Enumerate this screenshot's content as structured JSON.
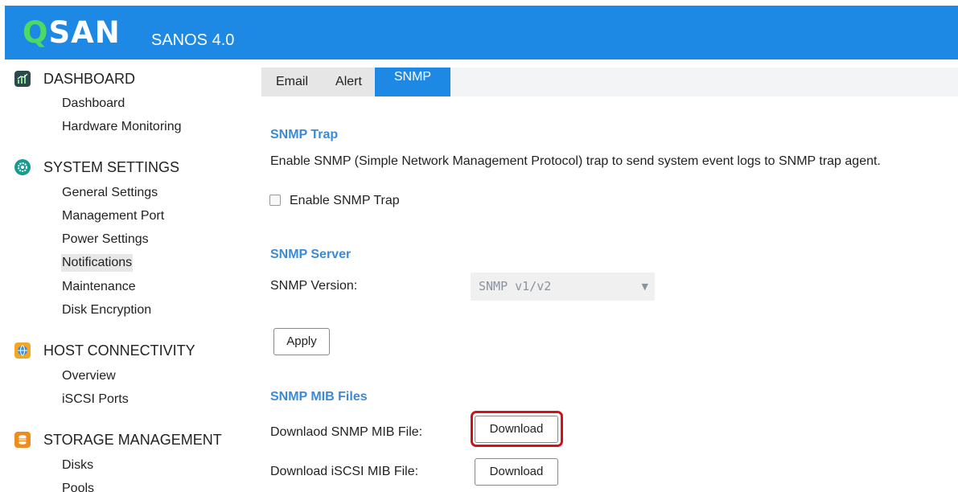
{
  "header": {
    "logo_q": "Q",
    "logo_rest": "SAN",
    "title": "SANOS 4.0",
    "bg_color": "#1e88e5"
  },
  "sidebar": {
    "sections": [
      {
        "label": "DASHBOARD",
        "icon": "dashboard-chart-icon",
        "items": [
          "Dashboard",
          "Hardware Monitoring"
        ]
      },
      {
        "label": "SYSTEM SETTINGS",
        "icon": "settings-gear-icon",
        "items": [
          "General Settings",
          "Management Port",
          "Power Settings",
          "Notifications",
          "Maintenance",
          "Disk Encryption"
        ]
      },
      {
        "label": "HOST CONNECTIVITY",
        "icon": "globe-icon",
        "items": [
          "Overview",
          "iSCSI Ports"
        ]
      },
      {
        "label": "STORAGE MANAGEMENT",
        "icon": "database-icon",
        "items": [
          "Disks",
          "Pools"
        ]
      }
    ],
    "active_item": "Notifications"
  },
  "tabs": [
    {
      "label": "Email",
      "active": false
    },
    {
      "label": "Alert",
      "active": false
    },
    {
      "label": "SNMP",
      "active": true
    }
  ],
  "snmp_trap": {
    "heading": "SNMP Trap",
    "description": "Enable SNMP (Simple Network Management Protocol) trap to send system event logs to SNMP trap agent.",
    "checkbox_label": "Enable SNMP Trap",
    "checked": false
  },
  "snmp_server": {
    "heading": "SNMP Server",
    "version_label": "SNMP Version:",
    "version_value": "SNMP v1/v2",
    "apply_label": "Apply"
  },
  "mib_files": {
    "heading": "SNMP MIB Files",
    "snmp_label": "Downlaod SNMP MIB File:",
    "snmp_button": "Download",
    "iscsi_label": "Download iSCSI MIB File:",
    "iscsi_button": "Download"
  },
  "colors": {
    "accent": "#1e88e5",
    "heading": "#3b8ad9",
    "highlight": "#d0131b"
  }
}
